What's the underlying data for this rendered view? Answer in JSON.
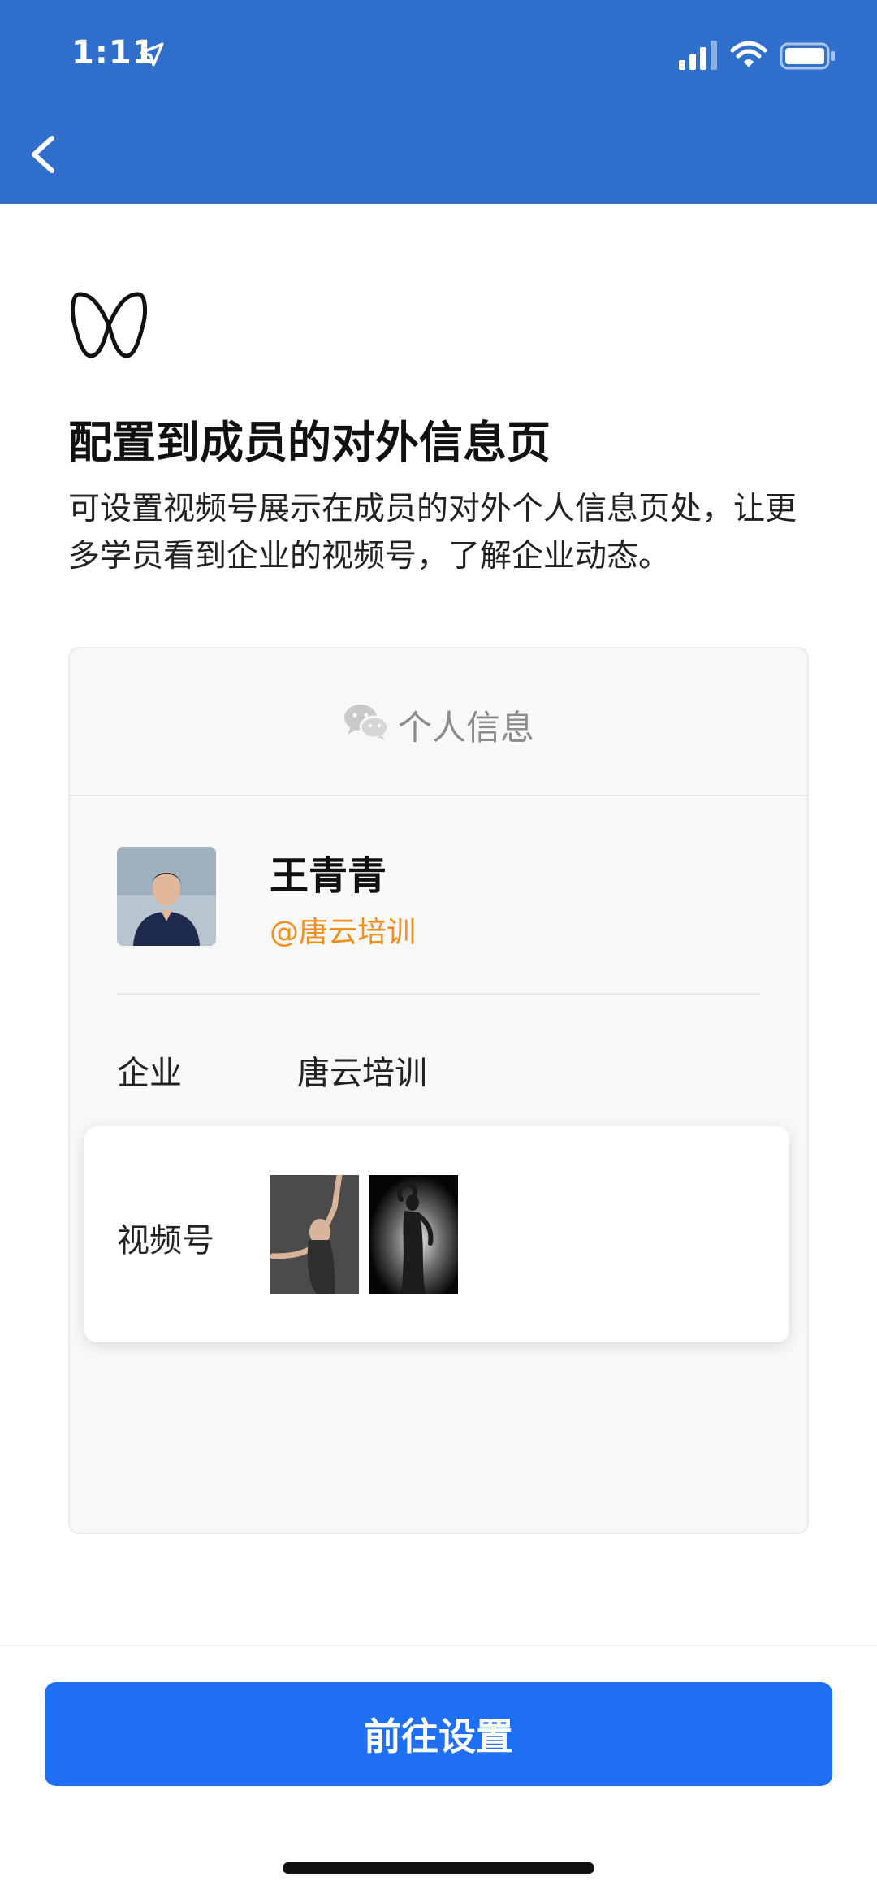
{
  "status_bar": {
    "time": "1:11"
  },
  "nav": {
    "back_icon": "chevron-left-icon"
  },
  "intro": {
    "logo_icon": "channels-logo-icon",
    "title": "配置到成员的对外信息页",
    "description": "可设置视频号展示在成员的对外个人信息页处，让更多学员看到企业的视频号，了解企业动态。"
  },
  "preview": {
    "header_icon": "wechat-icon",
    "header_title": "个人信息",
    "member": {
      "name": "王青青",
      "company_tag": "@唐云培训"
    },
    "company_row": {
      "label": "企业",
      "value": "唐云培训"
    },
    "channels_row": {
      "label": "视频号",
      "thumbnails": [
        "dancer-photo",
        "dancer-photo-dark"
      ]
    }
  },
  "footer": {
    "primary_button_label": "前往设置"
  },
  "colors": {
    "nav_bar": "#3070cc",
    "primary_button": "#1e6ff2",
    "company_tag": "#f0901a"
  }
}
